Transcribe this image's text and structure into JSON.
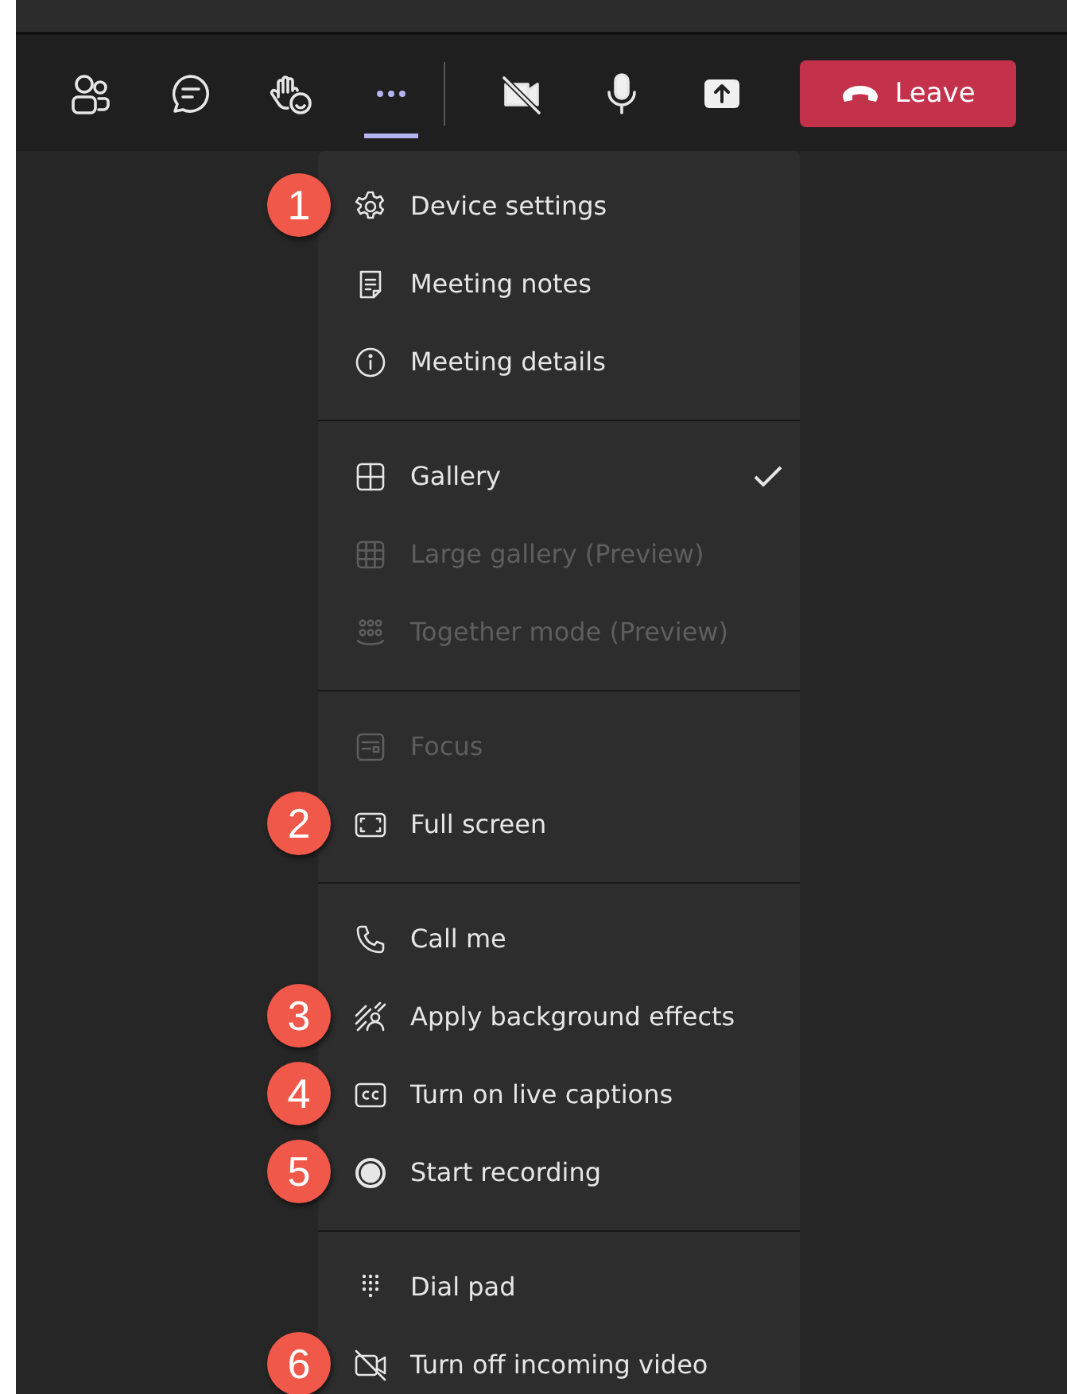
{
  "toolbar": {
    "buttons": [
      {
        "kind": "people",
        "selected": false
      },
      {
        "kind": "chat",
        "selected": false
      },
      {
        "kind": "reactions",
        "selected": false
      },
      {
        "kind": "more",
        "selected": true
      },
      {
        "kind": "camera-off",
        "selected": false
      },
      {
        "kind": "mic",
        "selected": false
      },
      {
        "kind": "share",
        "selected": false
      }
    ],
    "leave_button": {
      "label": "Leave"
    }
  },
  "menu": {
    "sections": [
      {
        "items": [
          {
            "label": "Device settings",
            "disabled": false,
            "checked": false,
            "badge": "1"
          },
          {
            "label": "Meeting notes",
            "disabled": false,
            "checked": false
          },
          {
            "label": "Meeting details",
            "disabled": false,
            "checked": false
          }
        ]
      },
      {
        "items": [
          {
            "label": "Gallery",
            "disabled": false,
            "checked": true
          },
          {
            "label": "Large gallery (Preview)",
            "disabled": true,
            "checked": false
          },
          {
            "label": "Together mode (Preview)",
            "disabled": true,
            "checked": false
          }
        ]
      },
      {
        "items": [
          {
            "label": "Focus",
            "disabled": true,
            "checked": false
          },
          {
            "label": "Full screen",
            "disabled": false,
            "checked": false,
            "badge": "2"
          }
        ]
      },
      {
        "items": [
          {
            "label": "Call me",
            "disabled": false,
            "checked": false
          },
          {
            "label": "Apply background effects",
            "disabled": false,
            "checked": false,
            "badge": "3"
          },
          {
            "label": "Turn on live captions",
            "disabled": false,
            "checked": false,
            "badge": "4"
          },
          {
            "label": "Start recording",
            "disabled": false,
            "checked": false,
            "badge": "5"
          }
        ]
      },
      {
        "items": [
          {
            "label": "Dial pad",
            "disabled": false,
            "checked": false
          },
          {
            "label": "Turn off incoming video",
            "disabled": false,
            "checked": false,
            "badge": "6"
          }
        ]
      }
    ]
  }
}
